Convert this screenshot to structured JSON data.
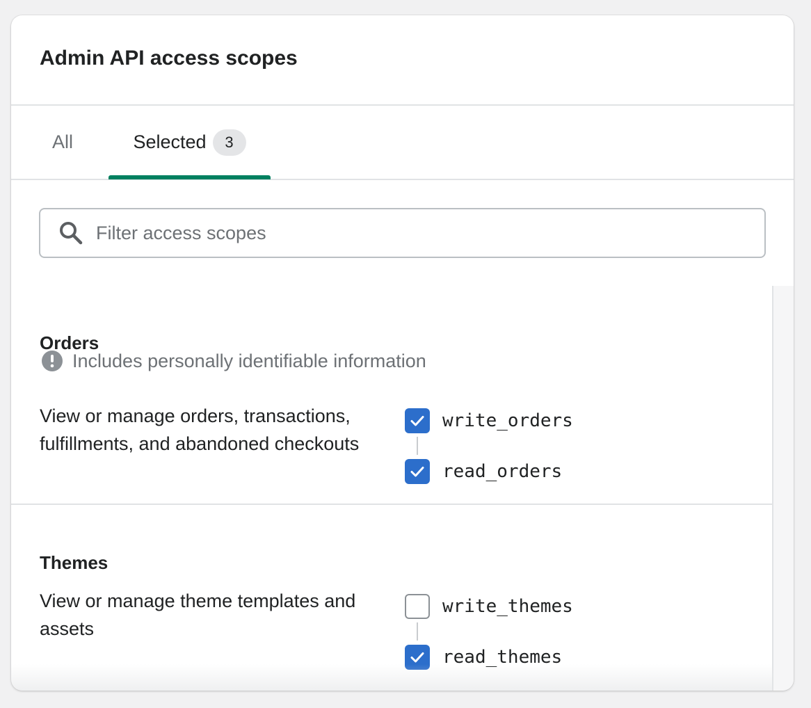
{
  "header": {
    "title": "Admin API access scopes"
  },
  "tabs": [
    {
      "label": "All"
    },
    {
      "label": "Selected",
      "badge": "3"
    }
  ],
  "search": {
    "placeholder": "Filter access scopes",
    "value": ""
  },
  "sections": [
    {
      "title": "Orders",
      "notice": "Includes personally identifiable information",
      "description": "View or manage orders, transactions, fulfillments, and abandoned checkouts",
      "scopes": [
        {
          "name": "write_orders",
          "checked": true
        },
        {
          "name": "read_orders",
          "checked": true
        }
      ]
    },
    {
      "title": "Themes",
      "description": "View or manage theme templates and assets",
      "scopes": [
        {
          "name": "write_themes",
          "checked": false
        },
        {
          "name": "read_themes",
          "checked": true
        }
      ]
    }
  ],
  "colors": {
    "accent_tab": "#008060",
    "checkbox_checked": "#2c6ecb",
    "text_subdued": "#6d7175",
    "border": "#e1e3e5"
  }
}
